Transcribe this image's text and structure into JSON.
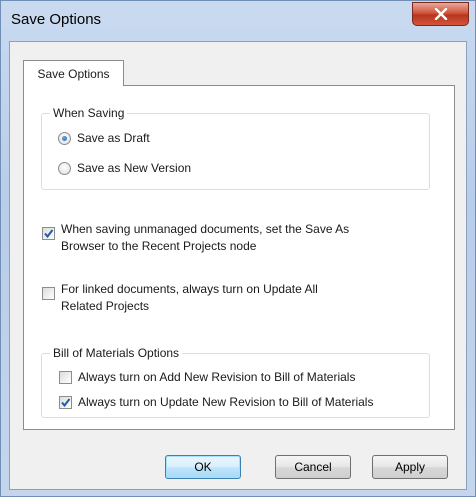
{
  "window": {
    "title": "Save Options"
  },
  "tabs": [
    {
      "label": "Save Options",
      "selected": true
    }
  ],
  "when_saving": {
    "legend": "When Saving",
    "options": [
      {
        "label": "Save as Draft",
        "selected": true
      },
      {
        "label": "Save as New Version",
        "selected": false
      }
    ]
  },
  "options": {
    "unmanaged": {
      "line1": "When saving unmanaged documents, set the Save As",
      "line2": "Browser to the Recent Projects node",
      "checked": true
    },
    "linked": {
      "line1": "For linked documents, always turn on Update All",
      "line2": "Related Projects",
      "checked": false
    }
  },
  "bom": {
    "legend": "Bill of Materials Options",
    "items": [
      {
        "label": "Always turn on Add New Revision to Bill of Materials",
        "checked": false
      },
      {
        "label": "Always turn on Update New Revision to Bill of Materials",
        "checked": true
      }
    ]
  },
  "buttons": {
    "ok": "OK",
    "cancel": "Cancel",
    "apply": "Apply"
  },
  "icons": {
    "close": "close-icon",
    "check": "checkmark-icon"
  },
  "colors": {
    "accent": "#1d5eaa",
    "close_button": "#c9452c",
    "title_bar": "#c2d5ee"
  }
}
